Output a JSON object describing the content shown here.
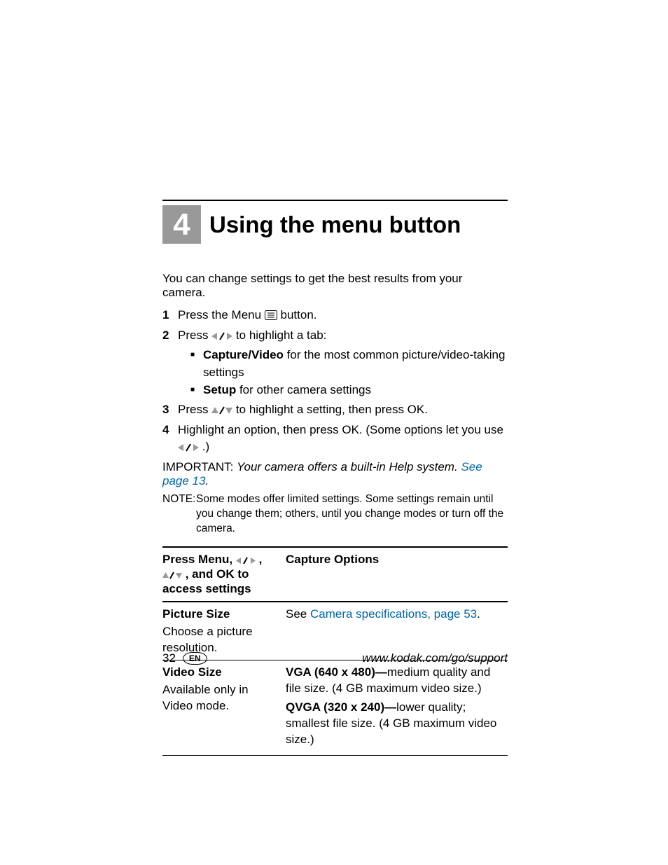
{
  "chapter": {
    "number": "4",
    "title": "Using the menu button"
  },
  "intro": "You can change settings to get the best results from your camera.",
  "steps": {
    "s1_a": "Press the Menu ",
    "s1_b": " button.",
    "s2_a": "Press ",
    "s2_b": " to highlight a tab:",
    "s2_sub1_bold": "Capture/Video",
    "s2_sub1_rest": " for the most common picture/video-taking settings",
    "s2_sub2_bold": "Setup",
    "s2_sub2_rest": " for other camera settings",
    "s3_a": "Press ",
    "s3_b": " to highlight a setting, then press OK.",
    "s4_a": "Highlight an option, then press OK. (Some options let you use ",
    "s4_b": " .)"
  },
  "important": {
    "label": "IMPORTANT:",
    "body": "Your camera offers a built-in Help system. ",
    "link": "See page 13",
    "after": "."
  },
  "note": {
    "label": "NOTE:",
    "body": "Some modes offer limited settings. Some settings remain until you change them; others, until you change modes or turn off the camera."
  },
  "table": {
    "head_left_a": "Press Menu, ",
    "head_left_b": " , ",
    "head_left_c": " , and OK to access settings",
    "head_right": "Capture Options",
    "r1": {
      "title": "Picture Size",
      "sub": "Choose a picture resolution.",
      "right_a": "See ",
      "right_link": "Camera specifications, page 53",
      "right_b": "."
    },
    "r2": {
      "title": "Video Size",
      "sub": "Available only in Video mode.",
      "o1_bold": "VGA (640 x 480)—",
      "o1_rest": "medium quality and file size. (4 GB maximum video size.)",
      "o2_bold": "QVGA (320 x 240)—",
      "o2_rest": "lower quality; smallest file size. (4 GB maximum video size.)"
    }
  },
  "footer": {
    "page": "32",
    "lang": "EN",
    "url": "www.kodak.com/go/support"
  }
}
